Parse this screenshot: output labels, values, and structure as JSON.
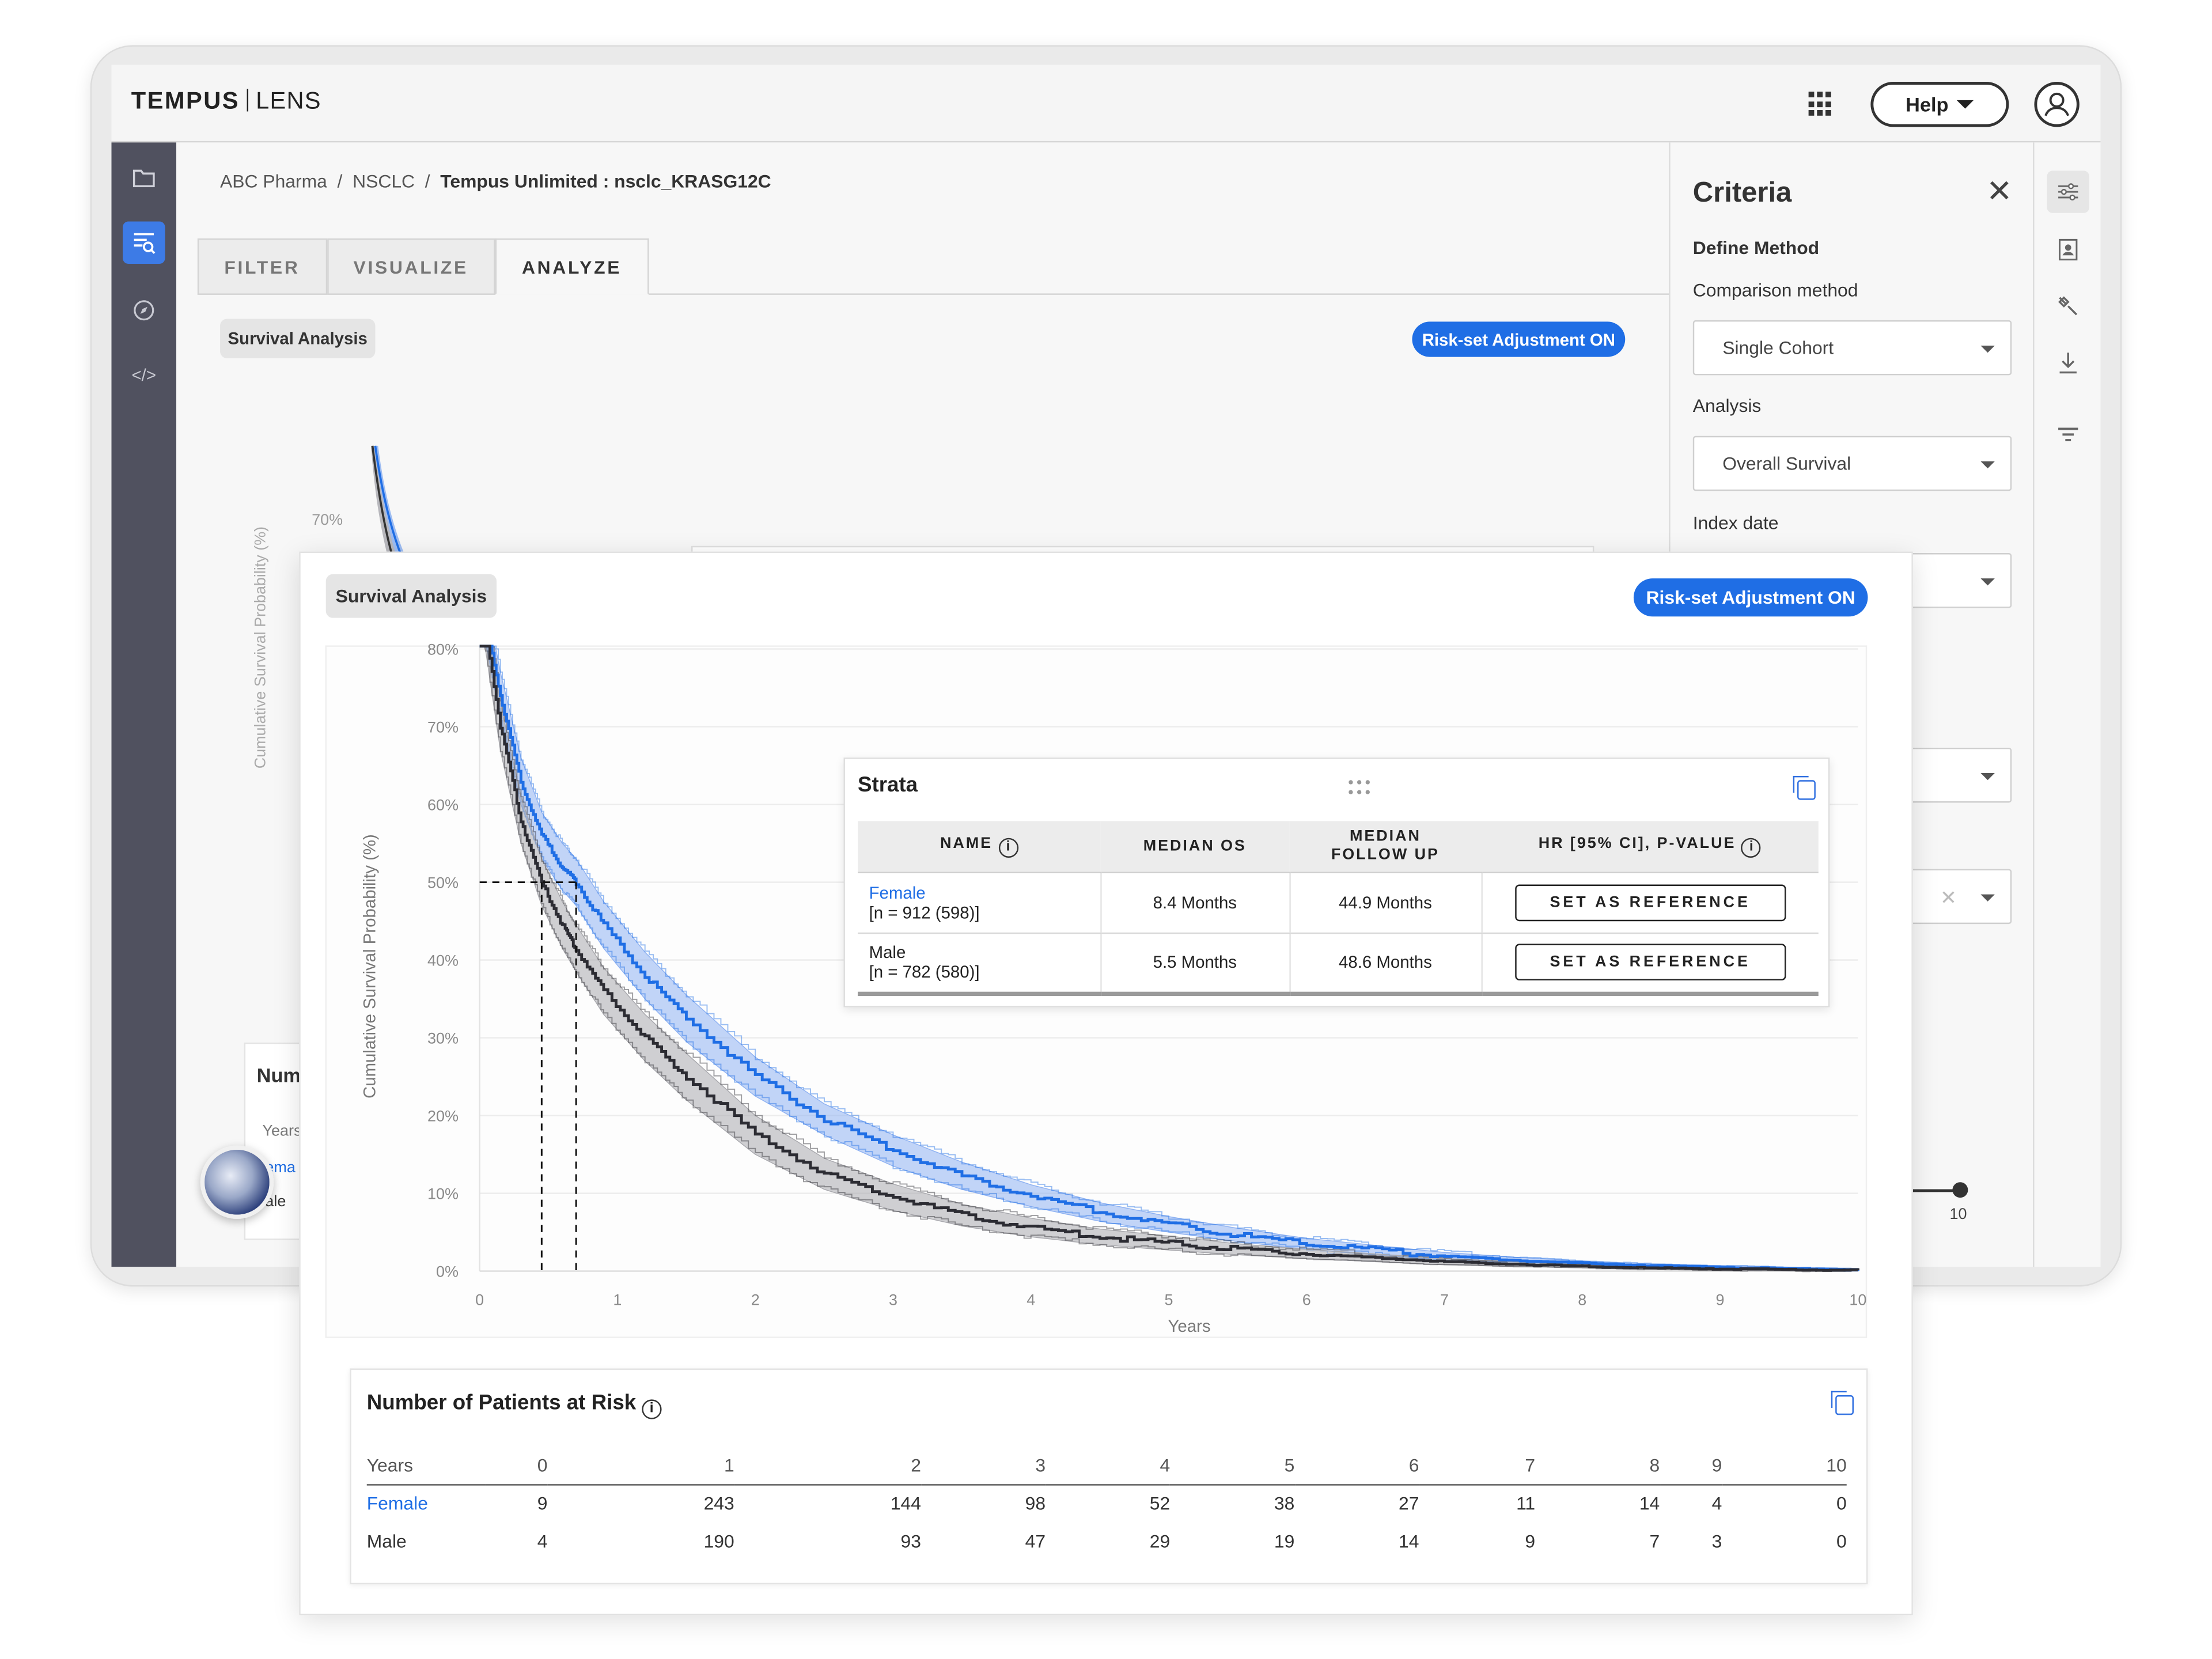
{
  "app": {
    "brand_primary": "TEMPUS",
    "brand_secondary": "LENS",
    "help_label": "Help"
  },
  "breadcrumb": {
    "org": "ABC Pharma",
    "cohort": "NSCLC",
    "project": "Tempus Unlimited : nsclc_KRASG12C"
  },
  "tabs": [
    {
      "label": "FILTER"
    },
    {
      "label": "VISUALIZE"
    },
    {
      "label": "ANALYZE"
    }
  ],
  "panel": {
    "chip": "Survival Analysis",
    "risk_toggle": "Risk-set Adjustment ON"
  },
  "criteria": {
    "title": "Criteria",
    "define_method": "Define Method",
    "comparison_label": "Comparison method",
    "comparison_value": "Single Cohort",
    "analysis_label": "Analysis",
    "analysis_value": "Overall Survival",
    "index_label": "Index date",
    "slider_end": "10"
  },
  "strata": {
    "title": "Strata",
    "headers": {
      "name": "NAME",
      "median_os": "MEDIAN OS",
      "median_fu_line1": "MEDIAN",
      "median_fu_line2": "FOLLOW UP",
      "hr": "HR [95% CI], P-VALUE"
    },
    "rows": [
      {
        "name": "Female",
        "n": "[n = 912 (598)]",
        "median_os": "8.4 Months",
        "median_fu": "44.9 Months",
        "action": "SET AS REFERENCE"
      },
      {
        "name": "Male",
        "n": "[n = 782 (580)]",
        "median_os": "5.5 Months",
        "median_fu": "48.6 Months",
        "action": "SET AS REFERENCE"
      }
    ]
  },
  "risk_table": {
    "title": "Number of Patients at Risk",
    "years_label": "Years",
    "years": [
      "0",
      "1",
      "2",
      "3",
      "4",
      "5",
      "6",
      "7",
      "8",
      "9",
      "10"
    ],
    "rows": [
      {
        "name": "Female",
        "values": [
          "9",
          "243",
          "144",
          "98",
          "52",
          "38",
          "27",
          "11",
          "14",
          "4",
          "0"
        ]
      },
      {
        "name": "Male",
        "values": [
          "4",
          "190",
          "93",
          "47",
          "29",
          "19",
          "14",
          "9",
          "7",
          "3",
          "0"
        ]
      }
    ]
  },
  "bg_partial": {
    "risk_title": "Num",
    "years": "Years",
    "female": "ema",
    "male": "ale"
  },
  "chart_data": {
    "type": "line",
    "ylabel": "Cumulative Survival Probability (%)",
    "xlabel": "Years",
    "xlim": [
      0,
      10
    ],
    "ylim": [
      0,
      80
    ],
    "x_ticks": [
      "0",
      "1",
      "2",
      "3",
      "4",
      "5",
      "6",
      "7",
      "8",
      "9",
      "10"
    ],
    "y_ticks": [
      "0%",
      "10%",
      "20%",
      "30%",
      "40%",
      "50%",
      "60%",
      "70%",
      "80%"
    ],
    "x": [
      0,
      0.15,
      0.3,
      0.45,
      0.6,
      0.7,
      0.9,
      1.2,
      1.5,
      2,
      2.5,
      3,
      3.5,
      4,
      4.5,
      5,
      5.5,
      6,
      6.5,
      7,
      7.5,
      8,
      8.5,
      9,
      9.5,
      10
    ],
    "series": [
      {
        "name": "Female",
        "color": "#1f6ee5",
        "band_color": "#8fb2f2",
        "values": [
          88,
          74,
          63,
          56,
          52,
          50,
          44.5,
          38,
          32.5,
          25,
          19.5,
          15.5,
          12.2,
          9.7,
          7.6,
          6.0,
          4.6,
          3.5,
          2.7,
          1.9,
          1.4,
          1.0,
          0.7,
          0.5,
          0.3,
          0.2
        ],
        "lower": [
          85,
          71,
          60,
          53,
          49,
          47,
          41.5,
          35,
          29.5,
          22.5,
          17.5,
          13.5,
          10.5,
          8.3,
          6.4,
          5.0,
          3.8,
          2.8,
          2.1,
          1.4,
          1.0,
          0.7,
          0.4,
          0.3,
          0.1,
          0.0
        ],
        "upper": [
          91,
          77,
          66,
          59,
          55,
          53,
          47.5,
          41,
          35.5,
          27.5,
          21.5,
          17.5,
          14,
          11.1,
          8.8,
          7.0,
          5.5,
          4.2,
          3.3,
          2.4,
          1.8,
          1.3,
          0.9,
          0.7,
          0.5,
          0.3
        ]
      },
      {
        "name": "Male",
        "color": "#2c2c33",
        "band_color": "#a9a9ae",
        "values": [
          88,
          70,
          58,
          50,
          44.5,
          41.5,
          36,
          30,
          25,
          17.5,
          12.5,
          9.5,
          7.2,
          5.6,
          4.4,
          3.6,
          2.8,
          2.2,
          1.7,
          1.2,
          0.9,
          0.6,
          0.4,
          0.3,
          0.2,
          0.1
        ],
        "lower": [
          85,
          67,
          55,
          47,
          41.5,
          38.5,
          33,
          27,
          22,
          15,
          10.5,
          7.8,
          5.8,
          4.4,
          3.4,
          2.7,
          2.1,
          1.6,
          1.2,
          0.8,
          0.6,
          0.4,
          0.2,
          0.1,
          0.0,
          0.0
        ],
        "upper": [
          91,
          73,
          61,
          53,
          47.5,
          44.5,
          39,
          33,
          28,
          20,
          14.5,
          11.2,
          8.6,
          6.8,
          5.4,
          4.5,
          3.5,
          2.8,
          2.2,
          1.6,
          1.2,
          0.8,
          0.6,
          0.5,
          0.3,
          0.2
        ]
      }
    ],
    "median_reference": {
      "y": 50,
      "x_male": 0.45,
      "x_female": 0.7
    }
  }
}
